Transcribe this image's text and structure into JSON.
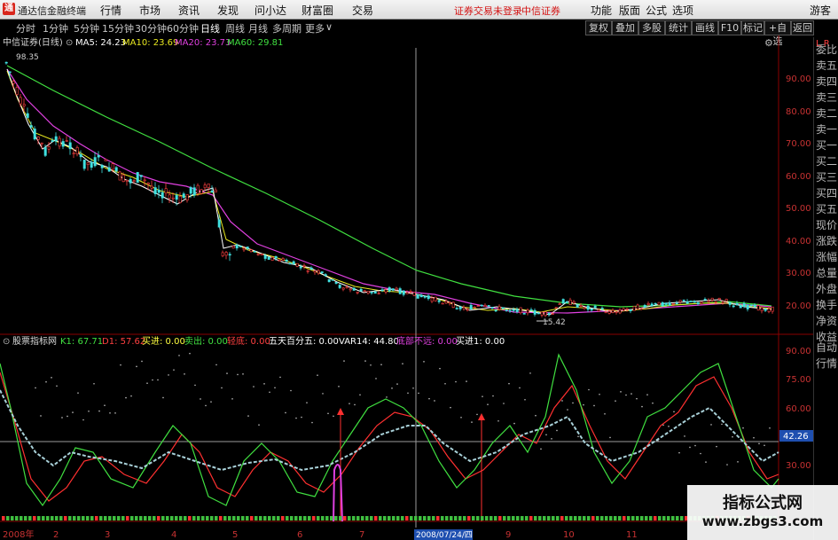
{
  "app": {
    "name": "通达信金融终端",
    "menu": [
      "行情",
      "市场",
      "资讯",
      "发现",
      "问小达",
      "财富圈",
      "交易"
    ],
    "notice": "证券交易未登录",
    "broker": "中信证券",
    "right_menu": [
      "功能",
      "版面",
      "公式",
      "选项"
    ],
    "guest": "游客"
  },
  "timeframes": {
    "items": [
      "分时",
      "1分钟",
      "5分钟",
      "15分钟",
      "30分钟",
      "60分钟",
      "日线",
      "周线",
      "月线",
      "多周期",
      "更多"
    ],
    "active": "日线"
  },
  "toolbar_buttons": [
    "复权",
    "叠加",
    "多股",
    "统计",
    "画线",
    "F10",
    "标记",
    "+自选",
    "返回"
  ],
  "sidebar": {
    "top_marks": "L R",
    "items": [
      "委比",
      "卖五",
      "卖四",
      "卖三",
      "卖二",
      "卖一",
      "买一",
      "买二",
      "买三",
      "买四",
      "买五",
      "现价",
      "涨跌",
      "涨幅",
      "总量",
      "外盘",
      "换手",
      "净资",
      "收益"
    ],
    "bottom_items": [
      "自动",
      "行情"
    ]
  },
  "main_chart": {
    "title": "中信证券(日线)",
    "ma": [
      {
        "label": "MA5: 24.23",
        "color": "#ffffff"
      },
      {
        "label": "MA10: 23.69",
        "color": "#e8e820"
      },
      {
        "label": "MA20: 23.73",
        "color": "#e040e0"
      },
      {
        "label": "MA60: 29.81",
        "color": "#40e040"
      }
    ],
    "y_ticks": [
      "90.00",
      "80.00",
      "70.00",
      "60.00",
      "50.00",
      "40.00",
      "30.00",
      "20.00"
    ],
    "high_label": "98.35",
    "low_label": "15.42"
  },
  "indicator": {
    "title": "股票指标网",
    "items": [
      {
        "label": "K1: 67.71",
        "color": "#40e040"
      },
      {
        "label": "D1: 57.62",
        "color": "#ff4040"
      },
      {
        "label": "买进: 0.00",
        "color": "#ffff40"
      },
      {
        "label": "卖出: 0.00",
        "color": "#40e040"
      },
      {
        "label": "轻底: 0.00",
        "color": "#ff4040"
      },
      {
        "label": "五天百分五: 0.00",
        "color": "#ffffff"
      },
      {
        "label": "VAR14: 44.80",
        "color": "#ffffff"
      },
      {
        "label": "底部不远: 0.00",
        "color": "#e040e0"
      },
      {
        "label": "买进1: 0.00",
        "color": "#ffffff"
      }
    ],
    "y_ticks": [
      "90.00",
      "75.00",
      "60.00",
      "30.00"
    ],
    "current_value": "42.26"
  },
  "x_axis": {
    "labels": [
      "2008年",
      "2",
      "3",
      "4",
      "5",
      "6",
      "7",
      "2008/07/24/四",
      "9",
      "10",
      "11"
    ]
  },
  "watermark": {
    "line1": "指标公式网",
    "line2": "www.zbgs3.com"
  },
  "chart_data": {
    "type": "candlestick",
    "title": "中信证券(日线)",
    "price_range": [
      15.42,
      98.35
    ],
    "moving_averages": {
      "MA5": 24.23,
      "MA10": 23.69,
      "MA20": 23.73,
      "MA60": 29.81
    },
    "indicator_range": [
      0,
      100
    ],
    "indicator_values": {
      "K1": 67.71,
      "D1": 57.62,
      "VAR14": 44.8
    }
  }
}
